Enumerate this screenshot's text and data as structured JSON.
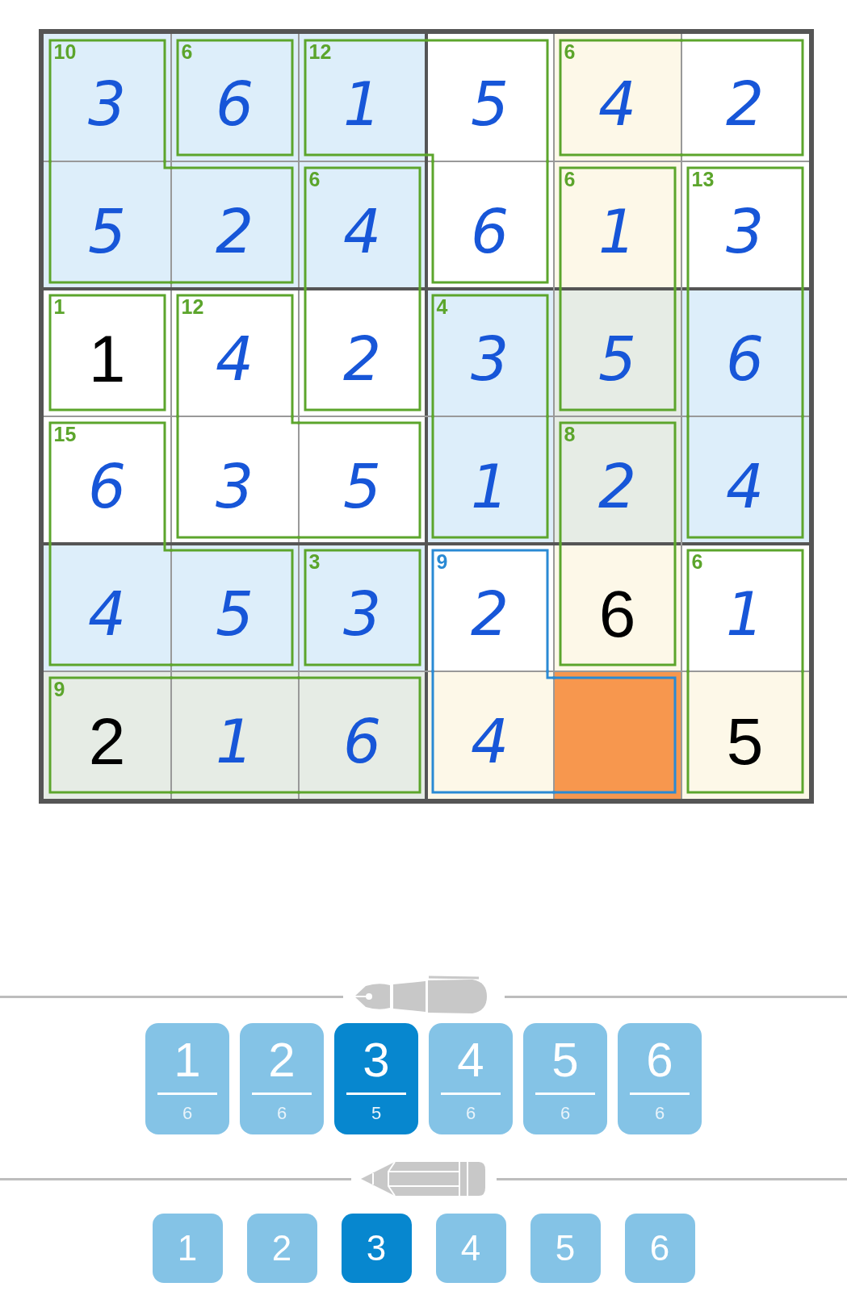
{
  "grid": {
    "rows": [
      [
        {
          "value": "3",
          "given": false,
          "selected": false,
          "color": "#ddeefa",
          "joins_right": false,
          "joins_down": true
        },
        {
          "value": "6",
          "given": false,
          "selected": false,
          "color": "#ddeefa",
          "joins_right": false,
          "joins_down": false
        },
        {
          "value": "1",
          "given": false,
          "selected": false,
          "color": "#ddeefa",
          "joins_right": true,
          "joins_down": false
        },
        {
          "value": "5",
          "given": false,
          "selected": false,
          "color": "#ffffff",
          "joins_right": false,
          "joins_down": true
        },
        {
          "value": "4",
          "given": false,
          "selected": false,
          "color": "#fdf8e8",
          "joins_right": true,
          "joins_down": false
        },
        {
          "value": "2",
          "given": false,
          "selected": false,
          "color": "#ffffff",
          "joins_down": false
        }
      ],
      [
        {
          "value": "5",
          "given": false,
          "selected": false,
          "color": "#ddeefa",
          "joins_right": true,
          "joins_down": false
        },
        {
          "value": "2",
          "given": false,
          "selected": false,
          "color": "#ddeefa",
          "joins_right": false,
          "joins_down": false
        },
        {
          "value": "4",
          "given": false,
          "selected": false,
          "color": "#ddeefa",
          "joins_right": false,
          "joins_down": true
        },
        {
          "value": "6",
          "given": false,
          "selected": false,
          "color": "#ffffff",
          "joins_right": false,
          "joins_down": false
        },
        {
          "value": "1",
          "given": false,
          "selected": false,
          "color": "#fdf8e8",
          "joins_right": false,
          "joins_down": true
        },
        {
          "value": "3",
          "given": false,
          "selected": false,
          "color": "#ffffff",
          "joins_down": true
        }
      ],
      [
        {
          "value": "1",
          "given": true,
          "selected": false,
          "color": "#ffffff",
          "joins_right": false,
          "joins_down": false
        },
        {
          "value": "4",
          "given": false,
          "selected": false,
          "color": "#ffffff",
          "joins_right": false,
          "joins_down": true
        },
        {
          "value": "2",
          "given": false,
          "selected": false,
          "color": "#ffffff",
          "joins_right": false,
          "joins_down": false
        },
        {
          "value": "3",
          "given": false,
          "selected": false,
          "color": "#ddeefa",
          "joins_right": false,
          "joins_down": true
        },
        {
          "value": "5",
          "given": false,
          "selected": false,
          "color": "#e6ece5",
          "joins_right": false,
          "joins_down": false
        },
        {
          "value": "6",
          "given": false,
          "selected": false,
          "color": "#ddeefa",
          "joins_down": true
        }
      ],
      [
        {
          "value": "6",
          "given": false,
          "selected": false,
          "color": "#ffffff",
          "joins_right": false,
          "joins_down": true
        },
        {
          "value": "3",
          "given": false,
          "selected": false,
          "color": "#ffffff",
          "joins_right": true,
          "joins_down": false
        },
        {
          "value": "5",
          "given": false,
          "selected": false,
          "color": "#ffffff",
          "joins_right": false,
          "joins_down": false
        },
        {
          "value": "1",
          "given": false,
          "selected": false,
          "color": "#ddeefa",
          "joins_right": false,
          "joins_down": false
        },
        {
          "value": "2",
          "given": false,
          "selected": false,
          "color": "#e6ece5",
          "joins_right": false,
          "joins_down": true
        },
        {
          "value": "4",
          "given": false,
          "selected": false,
          "color": "#ddeefa",
          "joins_down": false
        }
      ],
      [
        {
          "value": "4",
          "given": false,
          "selected": false,
          "color": "#ddeefa",
          "joins_right": true,
          "joins_down": false
        },
        {
          "value": "5",
          "given": false,
          "selected": false,
          "color": "#ddeefa",
          "joins_right": false,
          "joins_down": false
        },
        {
          "value": "3",
          "given": false,
          "selected": false,
          "color": "#ddeefa",
          "joins_right": false,
          "joins_down": false
        },
        {
          "value": "2",
          "given": false,
          "selected": false,
          "color": "#ffffff",
          "joins_right": false,
          "joins_down": true
        },
        {
          "value": "6",
          "given": true,
          "selected": false,
          "color": "#fdf8e8",
          "joins_right": false,
          "joins_down": false
        },
        {
          "value": "1",
          "given": false,
          "selected": false,
          "color": "#ffffff",
          "joins_down": true
        }
      ],
      [
        {
          "value": "2",
          "given": true,
          "selected": false,
          "color": "#e6ece5",
          "joins_right": true
        },
        {
          "value": "1",
          "given": false,
          "selected": false,
          "color": "#e6ece5",
          "joins_right": true
        },
        {
          "value": "6",
          "given": false,
          "selected": false,
          "color": "#e6ece5",
          "joins_right": false
        },
        {
          "value": "4",
          "given": false,
          "selected": false,
          "color": "#fdf8e8",
          "joins_right": true
        },
        {
          "selected": true,
          "joins_right": false
        },
        {
          "value": "5",
          "given": true,
          "selected": false,
          "color": "#fdf8e8"
        }
      ]
    ]
  },
  "cages": [
    {
      "sum": "10",
      "selected": false
    },
    {
      "sum": "6",
      "selected": false
    },
    {
      "sum": "12",
      "selected": false
    },
    {
      "sum": "6",
      "selected": false
    },
    {
      "sum": "6",
      "selected": false
    },
    {
      "sum": "6",
      "selected": false
    },
    {
      "sum": "13",
      "selected": false
    },
    {
      "sum": "1",
      "selected": false
    },
    {
      "sum": "12",
      "selected": false
    },
    {
      "sum": "4",
      "selected": false
    },
    {
      "sum": "15",
      "selected": false
    },
    {
      "sum": "8",
      "selected": false
    },
    {
      "sum": "3",
      "selected": false
    },
    {
      "sum": "9",
      "selected": true
    },
    {
      "sum": "6",
      "selected": false
    },
    {
      "sum": "9",
      "selected": false
    }
  ],
  "pen_palette": {
    "buttons": [
      {
        "digit": "1",
        "count": "6",
        "selected": false
      },
      {
        "digit": "2",
        "count": "6",
        "selected": false
      },
      {
        "digit": "3",
        "count": "5",
        "selected": true
      },
      {
        "digit": "4",
        "count": "6",
        "selected": false
      },
      {
        "digit": "5",
        "count": "6",
        "selected": false
      },
      {
        "digit": "6",
        "count": "6",
        "selected": false
      }
    ]
  },
  "pencil_palette": {
    "buttons": [
      {
        "digit": "1",
        "selected": false
      },
      {
        "digit": "2",
        "selected": false
      },
      {
        "digit": "3",
        "selected": true
      },
      {
        "digit": "4",
        "selected": false
      },
      {
        "digit": "5",
        "selected": false
      },
      {
        "digit": "6",
        "selected": false
      }
    ]
  }
}
